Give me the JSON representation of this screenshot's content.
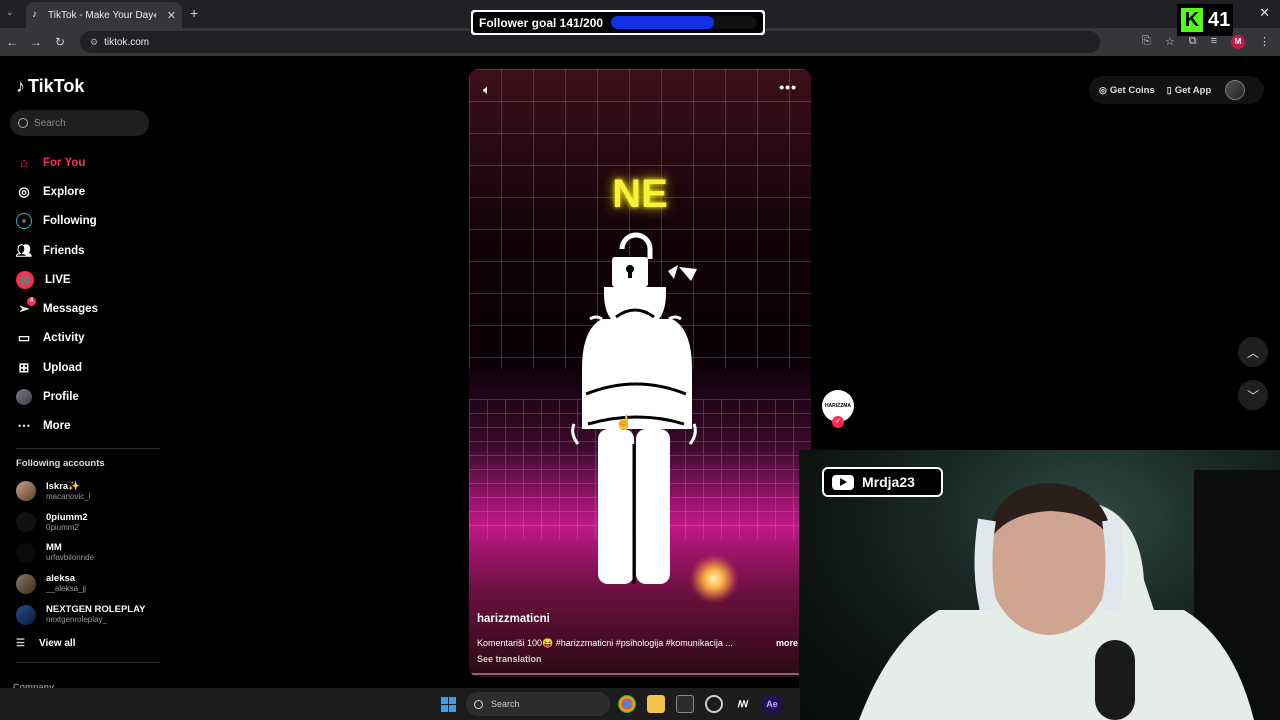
{
  "browser": {
    "tab_title": "TikTok - Make Your Day",
    "url": "tiktok.com",
    "new_tab": "+",
    "window_close": "✕"
  },
  "overlay": {
    "follower_goal_text": "Follower goal 141/200",
    "follower_goal_current": 141,
    "follower_goal_target": 200,
    "kick_count": "41",
    "kick_logo": "K",
    "youtube_name": "Mrdja23"
  },
  "sidebar": {
    "logo_text": "TikTok",
    "search_placeholder": "Search",
    "nav": [
      {
        "label": "For You",
        "icon": "home-icon",
        "active": true
      },
      {
        "label": "Explore",
        "icon": "compass-icon"
      },
      {
        "label": "Following",
        "icon": "following-icon"
      },
      {
        "label": "Friends",
        "icon": "friends-icon"
      },
      {
        "label": "LIVE",
        "icon": "live-icon"
      },
      {
        "label": "Messages",
        "icon": "messages-icon",
        "badge": "4"
      },
      {
        "label": "Activity",
        "icon": "activity-icon"
      },
      {
        "label": "Upload",
        "icon": "upload-icon"
      },
      {
        "label": "Profile",
        "icon": "profile-icon"
      },
      {
        "label": "More",
        "icon": "more-icon"
      }
    ],
    "following_title": "Following accounts",
    "following": [
      {
        "name": "Iskra✨",
        "handle": "macanovic_l"
      },
      {
        "name": "0piumm2",
        "handle": "0piumm2"
      },
      {
        "name": "MM",
        "handle": "urfavbilonnde"
      },
      {
        "name": "aleksa",
        "handle": "__aleksa_jj"
      },
      {
        "name": "NEXTGEN ROLEPLAY",
        "handle": "nextgenroleplay_"
      }
    ],
    "view_all": "View all",
    "company": "Company"
  },
  "video": {
    "overlay_text": "NE",
    "author": "harizzmaticni",
    "caption": "Komentariši 100😝 #harizzmaticni #psihologija #komunikacija ...",
    "more": "more",
    "see_translation": "See translation",
    "creator_avatar_text": "HARIZZMA"
  },
  "topright": {
    "get_coins": "Get Coins",
    "get_app": "Get App"
  },
  "taskbar": {
    "search_placeholder": "Search"
  }
}
